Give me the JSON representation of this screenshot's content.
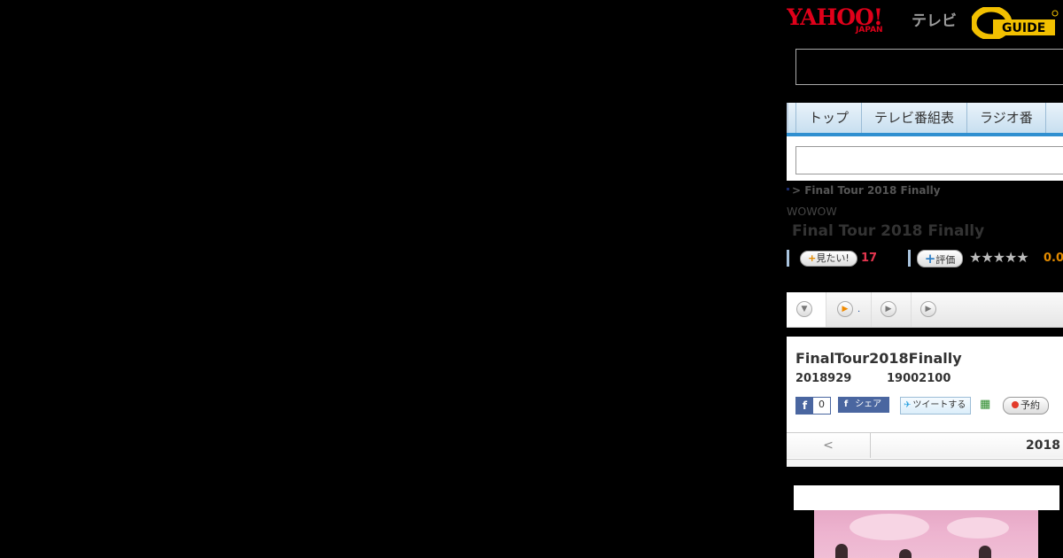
{
  "header": {
    "yahoo_logo": "YAHOO!",
    "yahoo_sub": "JAPAN",
    "tv_label": "テレビ",
    "gguide_logo": "G-GUIDE"
  },
  "tabs": [
    "トップ",
    "テレビ番組表",
    "ラジオ番"
  ],
  "breadcrumb": "> Final Tour 2018 Finally",
  "channel": "WOWOW",
  "title": "Final Tour 2018 Finally",
  "rating": {
    "mitai_label": "見たい!",
    "mitai_count": "17",
    "hyoka_label": "評価",
    "stars": "★★★★★",
    "score": "0.0"
  },
  "subnav": {
    "dot_label": "."
  },
  "program": {
    "title": "FinalTour2018Finally",
    "date": "2018929",
    "time": "19002100"
  },
  "social": {
    "like_count": "0",
    "share_label": "シェア",
    "tweet_label": "ツイートする",
    "reserve_label": "予約"
  },
  "date_nav": {
    "prev": "<",
    "current": "2018"
  }
}
